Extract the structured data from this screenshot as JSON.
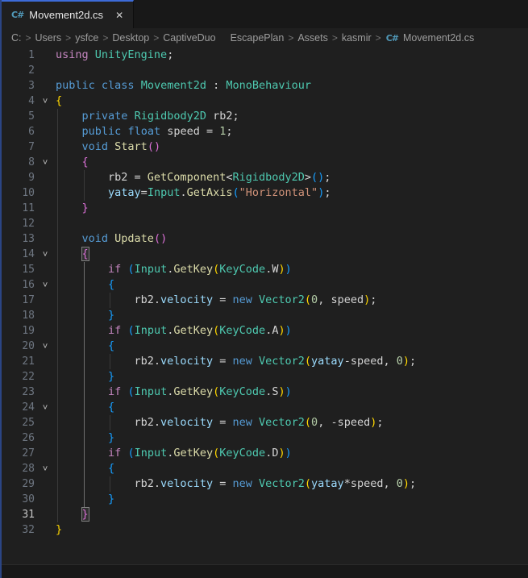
{
  "palette": {
    "bg": "#1f1f1f",
    "bg_dark": "#181818",
    "accent_tab": "#3d6bd8",
    "left_edge": "#2b4584",
    "line_number": "#6e7681",
    "line_number_active": "#c6c6c6",
    "icon_csharp": "#519aba",
    "keyword_blue": "#569CD6",
    "keyword_control": "#C586C0",
    "type_green": "#4EC9B0",
    "method_yellow": "#DCDCAA",
    "variable_blue": "#9CDCFE",
    "number_green": "#B5CEA8",
    "string_orange": "#CE9178",
    "plain": "#D4D4D4",
    "bracket_gold": "#FFD700",
    "bracket_pink": "#DA70D6",
    "bracket_blue": "#179FFF"
  },
  "icons": {
    "csharp": "C#",
    "close": "✕",
    "fold": "˅",
    "crumb_sep": ">"
  },
  "tab": {
    "title": "Movement2d.cs"
  },
  "breadcrumb": {
    "segments": [
      {
        "label": "C:"
      },
      {
        "label": "Users",
        "sep": true
      },
      {
        "label": "ysfce",
        "sep": true
      },
      {
        "label": "Desktop",
        "sep": true
      },
      {
        "label": "CaptiveDuo",
        "sep": true
      },
      {
        "label": "EscapePlan",
        "gap": true
      },
      {
        "label": "Assets",
        "sep": true
      },
      {
        "label": "kasmir",
        "sep": true
      },
      {
        "label": "Movement2d.cs",
        "sep": true,
        "icon": true
      }
    ]
  },
  "editor": {
    "lines": [
      {
        "n": 1,
        "tokens": [
          [
            "ctl",
            "using"
          ],
          [
            "pl",
            " "
          ],
          [
            "typ",
            "UnityEngine"
          ],
          [
            "pl",
            ";"
          ]
        ]
      },
      {
        "n": 2,
        "tokens": []
      },
      {
        "n": 3,
        "tokens": [
          [
            "kw",
            "public"
          ],
          [
            "pl",
            " "
          ],
          [
            "kw",
            "class"
          ],
          [
            "pl",
            " "
          ],
          [
            "typ",
            "Movement2d"
          ],
          [
            "pl",
            " : "
          ],
          [
            "typ",
            "MonoBehaviour"
          ]
        ]
      },
      {
        "n": 4,
        "fold": true,
        "tokens": [
          [
            "b1",
            "{"
          ]
        ]
      },
      {
        "n": 5,
        "tokens": [
          [
            "pl",
            "    "
          ],
          [
            "kw",
            "private"
          ],
          [
            "pl",
            " "
          ],
          [
            "typ",
            "Rigidbody2D"
          ],
          [
            "pl",
            " rb2;"
          ]
        ]
      },
      {
        "n": 6,
        "tokens": [
          [
            "pl",
            "    "
          ],
          [
            "kw",
            "public"
          ],
          [
            "pl",
            " "
          ],
          [
            "kw",
            "float"
          ],
          [
            "pl",
            " speed = "
          ],
          [
            "nm",
            "1"
          ],
          [
            "pl",
            ";"
          ]
        ]
      },
      {
        "n": 7,
        "tokens": [
          [
            "pl",
            "    "
          ],
          [
            "kw",
            "void"
          ],
          [
            "pl",
            " "
          ],
          [
            "fn",
            "Start"
          ],
          [
            "b2",
            "()"
          ]
        ]
      },
      {
        "n": 8,
        "fold": true,
        "tokens": [
          [
            "pl",
            "    "
          ],
          [
            "b2",
            "{"
          ]
        ]
      },
      {
        "n": 9,
        "tokens": [
          [
            "pl",
            "        rb2 = "
          ],
          [
            "fn",
            "GetComponent"
          ],
          [
            "pl",
            "<"
          ],
          [
            "typ",
            "Rigidbody2D"
          ],
          [
            "pl",
            ">"
          ],
          [
            "b3",
            "()"
          ],
          [
            "pl",
            ";"
          ]
        ]
      },
      {
        "n": 10,
        "tokens": [
          [
            "pl",
            "        "
          ],
          [
            "vr",
            "yatay"
          ],
          [
            "pl",
            "="
          ],
          [
            "typ",
            "Input"
          ],
          [
            "pl",
            "."
          ],
          [
            "fn",
            "GetAxis"
          ],
          [
            "b3",
            "("
          ],
          [
            "st",
            "\"Horizontal\""
          ],
          [
            "b3",
            ")"
          ],
          [
            "pl",
            ";"
          ]
        ]
      },
      {
        "n": 11,
        "tokens": [
          [
            "pl",
            "    "
          ],
          [
            "b2",
            "}"
          ]
        ]
      },
      {
        "n": 12,
        "tokens": []
      },
      {
        "n": 13,
        "tokens": [
          [
            "pl",
            "    "
          ],
          [
            "kw",
            "void"
          ],
          [
            "pl",
            " "
          ],
          [
            "fn",
            "Update"
          ],
          [
            "b2",
            "()"
          ]
        ]
      },
      {
        "n": 14,
        "fold": true,
        "tokens": [
          [
            "pl",
            "    "
          ],
          [
            "b2 boxed",
            "{"
          ]
        ]
      },
      {
        "n": 15,
        "tokens": [
          [
            "pl",
            "        "
          ],
          [
            "ctl",
            "if"
          ],
          [
            "pl",
            " "
          ],
          [
            "b3",
            "("
          ],
          [
            "typ",
            "Input"
          ],
          [
            "pl",
            "."
          ],
          [
            "fn",
            "GetKey"
          ],
          [
            "b1",
            "("
          ],
          [
            "typ",
            "KeyCode"
          ],
          [
            "pl",
            ".W"
          ],
          [
            "b1",
            ")"
          ],
          [
            "b3",
            ")"
          ]
        ]
      },
      {
        "n": 16,
        "fold": true,
        "tokens": [
          [
            "pl",
            "        "
          ],
          [
            "b3",
            "{"
          ]
        ]
      },
      {
        "n": 17,
        "tokens": [
          [
            "pl",
            "            rb2."
          ],
          [
            "vr",
            "velocity"
          ],
          [
            "pl",
            " = "
          ],
          [
            "kw",
            "new"
          ],
          [
            "pl",
            " "
          ],
          [
            "typ",
            "Vector2"
          ],
          [
            "b1",
            "("
          ],
          [
            "nm",
            "0"
          ],
          [
            "pl",
            ", speed"
          ],
          [
            "b1",
            ")"
          ],
          [
            "pl",
            ";"
          ]
        ]
      },
      {
        "n": 18,
        "tokens": [
          [
            "pl",
            "        "
          ],
          [
            "b3",
            "}"
          ]
        ]
      },
      {
        "n": 19,
        "tokens": [
          [
            "pl",
            "        "
          ],
          [
            "ctl",
            "if"
          ],
          [
            "pl",
            " "
          ],
          [
            "b3",
            "("
          ],
          [
            "typ",
            "Input"
          ],
          [
            "pl",
            "."
          ],
          [
            "fn",
            "GetKey"
          ],
          [
            "b1",
            "("
          ],
          [
            "typ",
            "KeyCode"
          ],
          [
            "pl",
            ".A"
          ],
          [
            "b1",
            ")"
          ],
          [
            "b3",
            ")"
          ]
        ]
      },
      {
        "n": 20,
        "fold": true,
        "tokens": [
          [
            "pl",
            "        "
          ],
          [
            "b3",
            "{"
          ]
        ]
      },
      {
        "n": 21,
        "tokens": [
          [
            "pl",
            "            rb2."
          ],
          [
            "vr",
            "velocity"
          ],
          [
            "pl",
            " = "
          ],
          [
            "kw",
            "new"
          ],
          [
            "pl",
            " "
          ],
          [
            "typ",
            "Vector2"
          ],
          [
            "b1",
            "("
          ],
          [
            "vr",
            "yatay"
          ],
          [
            "pl",
            "-speed, "
          ],
          [
            "nm",
            "0"
          ],
          [
            "b1",
            ")"
          ],
          [
            "pl",
            ";"
          ]
        ]
      },
      {
        "n": 22,
        "tokens": [
          [
            "pl",
            "        "
          ],
          [
            "b3",
            "}"
          ]
        ]
      },
      {
        "n": 23,
        "tokens": [
          [
            "pl",
            "        "
          ],
          [
            "ctl",
            "if"
          ],
          [
            "pl",
            " "
          ],
          [
            "b3",
            "("
          ],
          [
            "typ",
            "Input"
          ],
          [
            "pl",
            "."
          ],
          [
            "fn",
            "GetKey"
          ],
          [
            "b1",
            "("
          ],
          [
            "typ",
            "KeyCode"
          ],
          [
            "pl",
            ".S"
          ],
          [
            "b1",
            ")"
          ],
          [
            "b3",
            ")"
          ]
        ]
      },
      {
        "n": 24,
        "fold": true,
        "tokens": [
          [
            "pl",
            "        "
          ],
          [
            "b3",
            "{"
          ]
        ]
      },
      {
        "n": 25,
        "tokens": [
          [
            "pl",
            "            rb2."
          ],
          [
            "vr",
            "velocity"
          ],
          [
            "pl",
            " = "
          ],
          [
            "kw",
            "new"
          ],
          [
            "pl",
            " "
          ],
          [
            "typ",
            "Vector2"
          ],
          [
            "b1",
            "("
          ],
          [
            "nm",
            "0"
          ],
          [
            "pl",
            ", -speed"
          ],
          [
            "b1",
            ")"
          ],
          [
            "pl",
            ";"
          ]
        ]
      },
      {
        "n": 26,
        "tokens": [
          [
            "pl",
            "        "
          ],
          [
            "b3",
            "}"
          ]
        ]
      },
      {
        "n": 27,
        "tokens": [
          [
            "pl",
            "        "
          ],
          [
            "ctl",
            "if"
          ],
          [
            "pl",
            " "
          ],
          [
            "b3",
            "("
          ],
          [
            "typ",
            "Input"
          ],
          [
            "pl",
            "."
          ],
          [
            "fn",
            "GetKey"
          ],
          [
            "b1",
            "("
          ],
          [
            "typ",
            "KeyCode"
          ],
          [
            "pl",
            ".D"
          ],
          [
            "b1",
            ")"
          ],
          [
            "b3",
            ")"
          ]
        ]
      },
      {
        "n": 28,
        "fold": true,
        "tokens": [
          [
            "pl",
            "        "
          ],
          [
            "b3",
            "{"
          ]
        ]
      },
      {
        "n": 29,
        "tokens": [
          [
            "pl",
            "            rb2."
          ],
          [
            "vr",
            "velocity"
          ],
          [
            "pl",
            " = "
          ],
          [
            "kw",
            "new"
          ],
          [
            "pl",
            " "
          ],
          [
            "typ",
            "Vector2"
          ],
          [
            "b1",
            "("
          ],
          [
            "vr",
            "yatay"
          ],
          [
            "pl",
            "*speed, "
          ],
          [
            "nm",
            "0"
          ],
          [
            "b1",
            ")"
          ],
          [
            "pl",
            ";"
          ]
        ]
      },
      {
        "n": 30,
        "tokens": [
          [
            "pl",
            "        "
          ],
          [
            "b3",
            "}"
          ]
        ]
      },
      {
        "n": 31,
        "active": true,
        "cursor": true,
        "tokens": [
          [
            "pl",
            "    "
          ],
          [
            "b2 boxed",
            "}"
          ]
        ]
      },
      {
        "n": 32,
        "tokens": [
          [
            "b1",
            "}"
          ]
        ]
      }
    ],
    "indent_guides": [
      {
        "col": 0,
        "from": 5,
        "to": 31,
        "active": false
      },
      {
        "col": 4,
        "from": 9,
        "to": 10,
        "active": false
      },
      {
        "col": 4,
        "from": 15,
        "to": 30,
        "active": true
      },
      {
        "col": 8,
        "from": 17,
        "to": 17,
        "active": false
      },
      {
        "col": 8,
        "from": 21,
        "to": 21,
        "active": false
      },
      {
        "col": 8,
        "from": 25,
        "to": 25,
        "active": false
      },
      {
        "col": 8,
        "from": 29,
        "to": 29,
        "active": false
      }
    ]
  }
}
